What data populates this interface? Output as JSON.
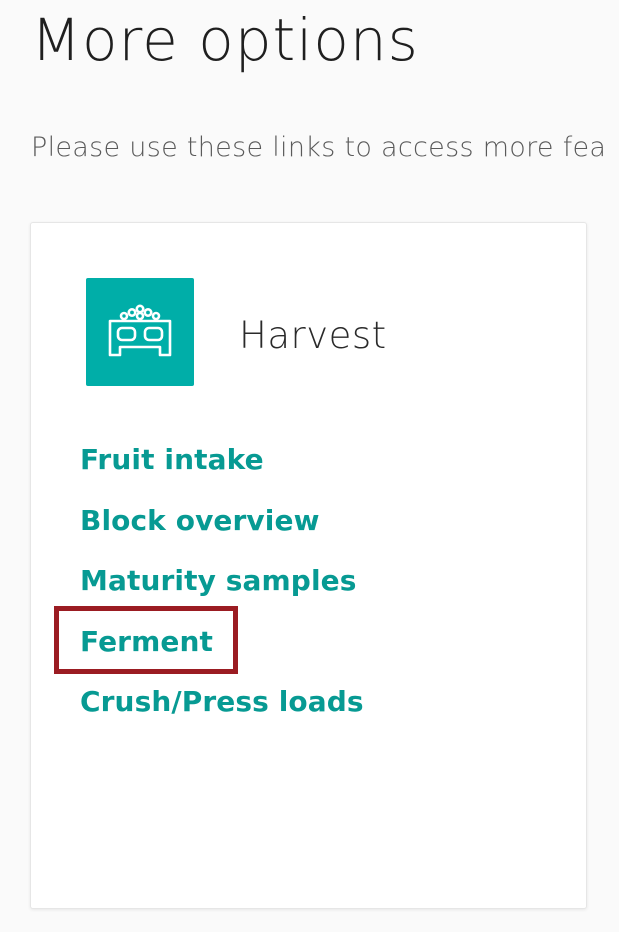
{
  "page": {
    "title": "More options",
    "subtitle": "Please use these links to access more fea"
  },
  "card": {
    "icon": "harvest-bin-icon",
    "title": "Harvest",
    "links": [
      "Fruit intake",
      "Block overview",
      "Maturity samples",
      "Ferment",
      "Crush/Press loads"
    ]
  },
  "highlight": {
    "target": "Ferment",
    "color": "#9b1c22"
  },
  "colors": {
    "accent": "#00aea8",
    "link": "#079a93",
    "highlight": "#9b1c22"
  }
}
